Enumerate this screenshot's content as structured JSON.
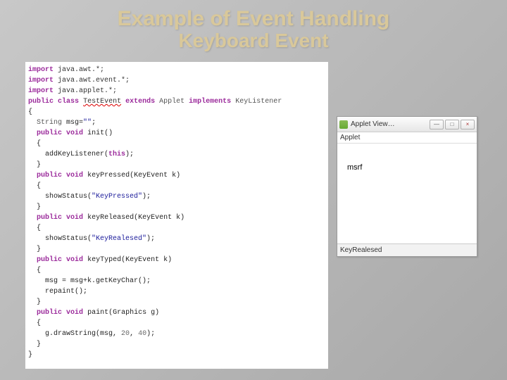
{
  "title_line1": "Example of Event Handling",
  "title_line2": "Keyboard Event",
  "code": {
    "import1a": "import",
    "import1b": " java.awt.*;",
    "import2a": "import",
    "import2b": " java.awt.event.*;",
    "import3a": "import",
    "import3b": " java.applet.*;",
    "pub": "public",
    "cls": "class",
    "clsname": "TestEvent",
    "ext": "extends",
    "app": "Applet",
    "impl": "implements",
    "klis": "KeyListener",
    "ob": "{",
    "fieldtype": "String",
    "fieldinit": " msg=",
    "emptystr": "\"\"",
    "semi": ";",
    "pub2": "public",
    "void2": "void",
    "init": " init()",
    "addlis": "addKeyListener(",
    "thisk": "this",
    "cp": ");",
    "cb": "}",
    "pub3": "public",
    "void3": "void",
    "kpress": " keyPressed(KeyEvent k)",
    "sstat": "showStatus(",
    "skp": "\"KeyPressed\"",
    "pub4": "public",
    "void4": "void",
    "krel": " keyReleased(KeyEvent k)",
    "skr": "\"KeyRealesed\"",
    "pub5": "public",
    "void5": "void",
    "ktyp": " keyTyped(KeyEvent k)",
    "msgassign": "msg = msg+k.getKeyChar();",
    "repaint": "repaint();",
    "pub6": "public",
    "void6": "void",
    "paint": " paint(Graphics g)",
    "gdraw": "g.drawString(msg, ",
    "n20": "20",
    "comma": ", ",
    "n40": "40",
    "endp": ");"
  },
  "applet": {
    "title": "Applet View…",
    "menu": "Applet",
    "canvas_text": "msrf",
    "status": "KeyRealesed",
    "min": "—",
    "max": "□",
    "close": "×"
  }
}
